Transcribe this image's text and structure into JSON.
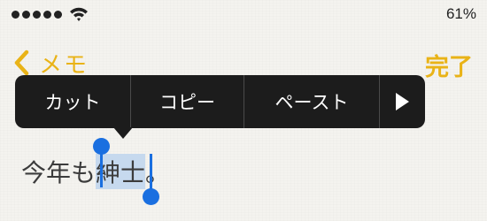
{
  "status_bar": {
    "signal_bars": 5,
    "wifi_icon": "wifi-icon",
    "battery": "61%"
  },
  "nav": {
    "back_icon": "chevron-left-icon",
    "back_label": "メモ",
    "done_label": "完了",
    "accent_color": "#e9b317"
  },
  "edit_menu": {
    "cut": "カット",
    "copy": "コピー",
    "paste": "ペースト",
    "more_icon": "play-icon"
  },
  "note": {
    "before": "今年も",
    "selected": "紳士",
    "after": "。"
  },
  "selection_color": "#1a6fe0"
}
